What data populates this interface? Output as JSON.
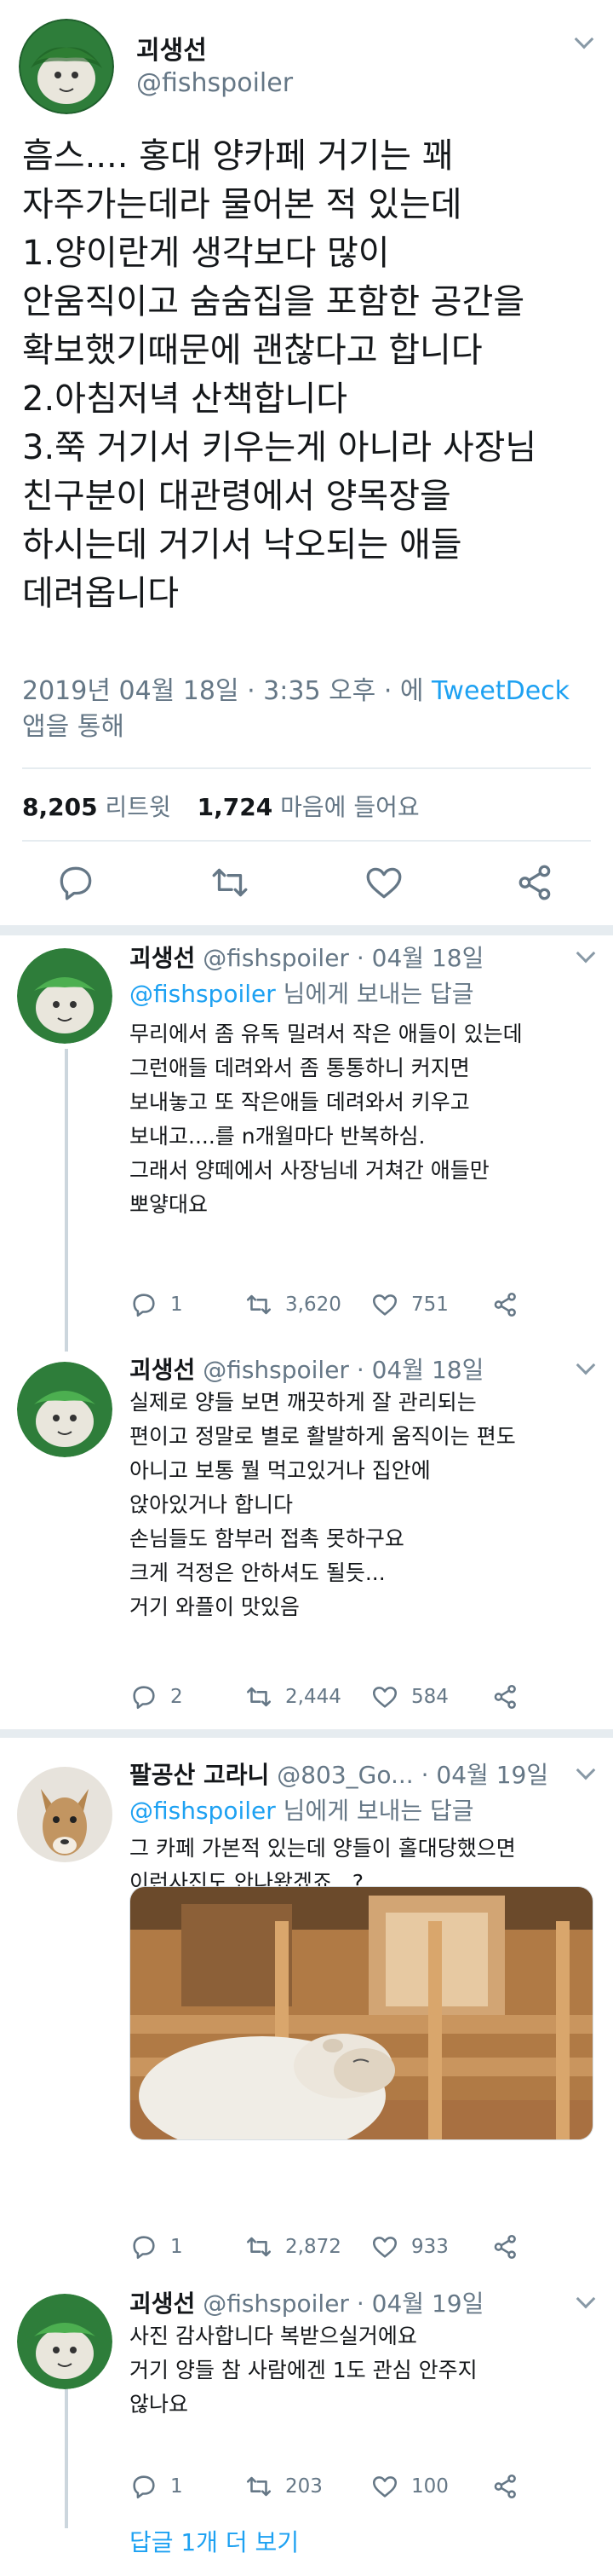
{
  "main_tweet": {
    "display_name": "괴생선",
    "handle": "@fishspoiler",
    "text_lines": [
      "흠스.... 홍대 양카페 거기는 꽤",
      "자주가는데라 물어본 적 있는데",
      "1.양이란게 생각보다 많이",
      "안움직이고 숨숨집을 포함한 공간을",
      "확보했기때문에 괜찮다고 합니다",
      "2.아침저녁 산책합니다",
      "3.쭉 거기서 키우는게 아니라 사장님",
      "친구분이 대관령에서 양목장을",
      "하시는데 거기서 낙오되는 애들",
      "데려옵니다"
    ],
    "timestamp": "2019년 04월 18일 · 3:35 오후 · 에",
    "client": "TweetDeck",
    "via": "앱을 통해",
    "retweets": "8,205",
    "retweets_label": "리트윗",
    "likes": "1,724",
    "likes_label": "마음에 들어요"
  },
  "replies": [
    {
      "display_name": "괴생선",
      "handle": "@fishspoiler · 04월 18일",
      "reply_to_handle": "@fishspoiler",
      "reply_to_suffix": "님에게 보내는 답글",
      "lines": [
        "무리에서 좀 유독 밀려서 작은 애들이 있는데",
        "그런애들 데려와서 좀 통통하니 커지면",
        "보내놓고 또 작은애들 데려와서 키우고",
        "보내고....를 n개월마다 반복하심.",
        "그래서 양떼에서 사장님네 거쳐간 애들만",
        "뽀얗대요"
      ],
      "replies_count": "1",
      "retweets_count": "3,620",
      "likes_count": "751"
    },
    {
      "display_name": "괴생선",
      "handle": "@fishspoiler · 04월 18일",
      "lines": [
        "실제로 양들 보면 깨끗하게 잘 관리되는",
        "편이고 정말로 별로 활발하게 움직이는 편도",
        "아니고 보통 뭘 먹고있거나 집안에",
        "앉아있거나 합니다",
        "손님들도 함부러 접촉 못하구요",
        "크게 걱정은 안하셔도 될듯...",
        "거기 와플이 맛있음"
      ],
      "replies_count": "2",
      "retweets_count": "2,444",
      "likes_count": "584"
    },
    {
      "display_name": "팔공산 고라니",
      "handle": "@803_Go... · 04월 19일",
      "reply_to_handle": "@fishspoiler",
      "reply_to_suffix": "님에게 보내는 답글",
      "lines": [
        "그 카페 가본적 있는데 양들이 홀대당했으면",
        "이런사진도 안나왔겠죠...?"
      ],
      "replies_count": "1",
      "retweets_count": "2,872",
      "likes_count": "933"
    },
    {
      "display_name": "괴생선",
      "handle": "@fishspoiler · 04월 19일",
      "lines": [
        "사진 감사합니다 복받으실거에요",
        "거기 양들 참 사람에겐 1도 관심 안주지",
        "않나요"
      ],
      "replies_count": "1",
      "retweets_count": "203",
      "likes_count": "100"
    }
  ],
  "more_replies_link": "답글 1개 더 보기",
  "icons": [
    "reply-icon",
    "retweet-icon",
    "like-icon",
    "share-icon",
    "chevron-down-icon"
  ],
  "colors": {
    "link": "#1da1f2",
    "muted": "#657786",
    "text": "#14171a",
    "divider": "#e6ecf0"
  }
}
